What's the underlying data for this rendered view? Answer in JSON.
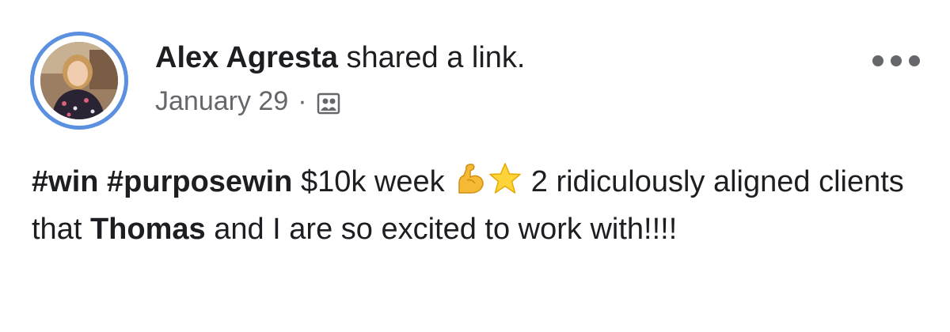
{
  "post": {
    "author": "Alex Agresta",
    "action": " shared a link.",
    "date": "January 29",
    "separator": "·",
    "audience_icon": "group-audience-icon",
    "more_icon": "more-options-icon",
    "body": {
      "hashtag_1": "#win",
      "hashtag_2": "#purposewin",
      "text_1": " $10k week ",
      "emoji_1": "flexed-biceps-icon",
      "emoji_2": "star-icon",
      "text_2": " 2 ridiculously aligned clients that ",
      "mention": "Thomas",
      "text_3": " and I are so excited to work with!!!!"
    }
  },
  "colors": {
    "avatar_ring": "#5b8fe0",
    "meta_text": "#65676b",
    "body_text": "#1c1e21"
  }
}
